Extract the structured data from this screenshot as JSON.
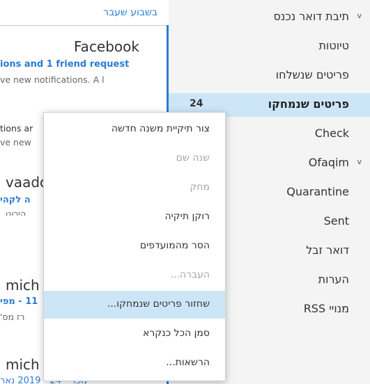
{
  "message_list": {
    "group_header": "בשבוע שעבר",
    "messages": [
      {
        "sender": "Facebook",
        "subject": "ions and 1 friend request",
        "preview": "ve new notifications.    A l"
      },
      {
        "sender": "",
        "subject": "tions ar",
        "preview": "ve new"
      },
      {
        "sender": "vaado",
        "subject": "ה לקהי",
        "preview": "היכונו ,"
      },
      {
        "sender": "mich",
        "subject": "11 - מפי",
        "preview": "רז מס'"
      },
      {
        "sender": "mich",
        "subject": "מפר - 24 - 2019 נאר",
        "preview": ""
      }
    ]
  },
  "folders": {
    "items": [
      {
        "label": "תיבת דואר נכנס",
        "chevron": "v",
        "count": ""
      },
      {
        "label": "טיוטות",
        "chevron": "",
        "count": ""
      },
      {
        "label": "פריטים שנשלחו",
        "chevron": "",
        "count": ""
      },
      {
        "label": "פריטים שנמחקו",
        "chevron": "",
        "count": "24"
      },
      {
        "label": "Check",
        "chevron": "",
        "count": ""
      },
      {
        "label": "Ofaqim",
        "chevron": "v",
        "count": ""
      },
      {
        "label": "Quarantine",
        "chevron": "",
        "count": ""
      },
      {
        "label": "Sent",
        "chevron": "",
        "count": ""
      },
      {
        "label": "דואר זבל",
        "chevron": "",
        "count": ""
      },
      {
        "label": "הערות",
        "chevron": "",
        "count": ""
      },
      {
        "label": "מנויי RSS",
        "chevron": "",
        "count": ""
      }
    ],
    "selected_index": 3
  },
  "context_menu": {
    "items": [
      {
        "label": "צור תיקיית משנה חדשה",
        "enabled": true
      },
      {
        "label": "שנה שם",
        "enabled": false
      },
      {
        "label": "מחק",
        "enabled": false
      },
      {
        "label": "רוקן תיקיה",
        "enabled": true
      },
      {
        "label": "הסר מהמועדפים",
        "enabled": true
      },
      {
        "label": "העברה...",
        "enabled": false
      },
      {
        "label": "שחזור פריטים שנמחקו...",
        "enabled": true
      },
      {
        "label": "סמן הכל כנקרא",
        "enabled": true
      },
      {
        "label": "הרשאות...",
        "enabled": true
      }
    ],
    "hovered_index": 6
  },
  "colors": {
    "accent": "#2b7cd3",
    "selection": "#cde6f7",
    "pane_bg": "#f4f4f4"
  }
}
